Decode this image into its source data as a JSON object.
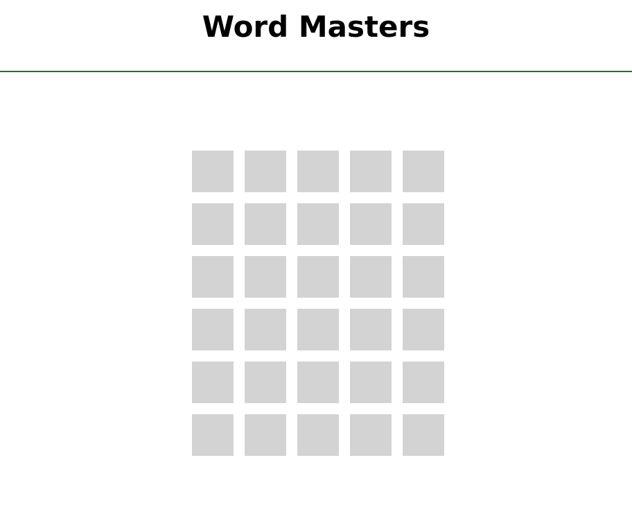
{
  "header": {
    "title": "Word Masters"
  },
  "colors": {
    "header_rule": "#008000",
    "tile_empty": "#d3d3d3",
    "background": "#ffffff"
  },
  "board": {
    "rows": [
      [
        "",
        "",
        "",
        "",
        ""
      ],
      [
        "",
        "",
        "",
        "",
        ""
      ],
      [
        "",
        "",
        "",
        "",
        ""
      ],
      [
        "",
        "",
        "",
        "",
        ""
      ],
      [
        "",
        "",
        "",
        "",
        ""
      ],
      [
        "",
        "",
        "",
        "",
        ""
      ]
    ]
  }
}
